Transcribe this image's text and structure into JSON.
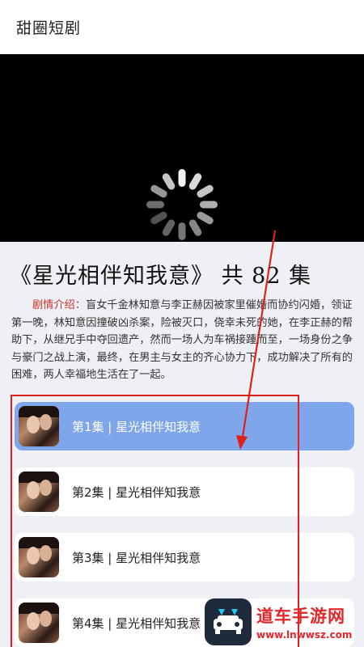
{
  "app": {
    "title": "甜圈短剧"
  },
  "player": {
    "state": "loading"
  },
  "drama": {
    "title": "《星光相伴知我意》 共 82 集",
    "synopsis_label": "剧情介绍：",
    "synopsis_text": "盲女千金林知意与李正赫因被家里催婚而协约闪婚，领证第一晚，林知意因撞破凶杀案，险被灭口，侥幸未死的她，在李正赫的帮助下，从继兄手中夺回遗产，然而一场人为车祸接踵而至，一场身份之争与豪门之战上演，最终，在男主与女主的齐心协力下，成功解决了所有的困难，两人幸福地生活在了一起。"
  },
  "episodes": [
    {
      "label": "第1集 | 星光相伴知我意",
      "active": true
    },
    {
      "label": "第2集 | 星光相伴知我意",
      "active": false
    },
    {
      "label": "第3集 | 星光相伴知我意",
      "active": false
    },
    {
      "label": "第4集 | 星光相伴知我意",
      "active": false
    }
  ],
  "watermark": {
    "main": "道车手游网",
    "sub": "www.lnwwsz.com"
  },
  "colors": {
    "accent": "#7fa6ea",
    "annotation": "#e0201c",
    "synopsis_label": "#d0312d"
  }
}
